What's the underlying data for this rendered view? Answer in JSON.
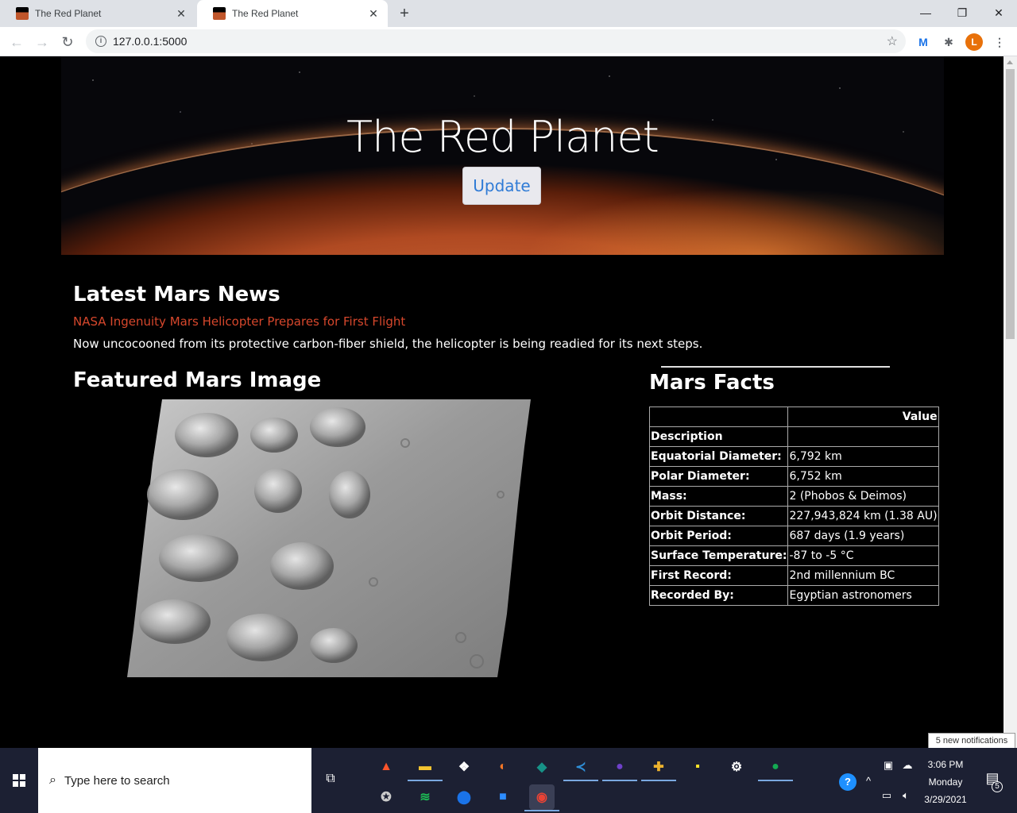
{
  "browser": {
    "tabs": [
      {
        "title": "The Red Planet",
        "active": false
      },
      {
        "title": "The Red Planet",
        "active": true
      }
    ],
    "new_tab_label": "+",
    "url": "127.0.0.1:5000",
    "profile_initial": "L",
    "window_controls": {
      "minimize": "—",
      "restore": "❐",
      "close": "✕"
    }
  },
  "page": {
    "site_title": "The Red Planet",
    "update_button": "Update",
    "news": {
      "heading": "Latest Mars News",
      "title": "NASA Ingenuity Mars Helicopter Prepares for First Flight",
      "teaser": "Now uncocooned from its protective carbon-fiber shield, the helicopter is being readied for its next steps."
    },
    "featured": {
      "heading": "Featured Mars Image"
    },
    "facts": {
      "heading": "Mars Facts",
      "header_row": [
        "",
        "Value"
      ],
      "index_label": "Description",
      "rows": [
        {
          "label": "Equatorial Diameter:",
          "value": "6,792 km"
        },
        {
          "label": "Polar Diameter:",
          "value": "6,752 km"
        },
        {
          "label": "Mass:",
          "value": "2 (Phobos & Deimos)"
        },
        {
          "label": "Orbit Distance:",
          "value": "227,943,824 km (1.38 AU)"
        },
        {
          "label": "Orbit Period:",
          "value": "687 days (1.9 years)"
        },
        {
          "label": "Surface Temperature:",
          "value": "-87 to -5 °C"
        },
        {
          "label": "First Record:",
          "value": "2nd millennium BC"
        },
        {
          "label": "Recorded By:",
          "value": "Egyptian astronomers"
        }
      ]
    }
  },
  "notification_toast": "5 new notifications",
  "taskbar": {
    "search_placeholder": "Type here to search",
    "clock": {
      "time": "3:06 PM",
      "day": "Monday",
      "date": "3/29/2021"
    },
    "notification_count": "5",
    "pinned_icons": [
      {
        "name": "brave-icon",
        "color": "#fb542b"
      },
      {
        "name": "file-explorer-icon",
        "color": "#f4c430"
      },
      {
        "name": "dropbox-icon",
        "color": "#ffffff"
      },
      {
        "name": "jupyter-icon",
        "color": "#f37626"
      },
      {
        "name": "gitkraken-icon",
        "color": "#179287"
      },
      {
        "name": "vscode-icon",
        "color": "#2f8fd8"
      },
      {
        "name": "github-desktop-icon",
        "color": "#6e40c9"
      },
      {
        "name": "slack-icon",
        "color": "#ecb22e"
      },
      {
        "name": "sticky-notes-icon",
        "color": "#ffe629"
      },
      {
        "name": "settings-icon",
        "color": "#ffffff"
      },
      {
        "name": "mongodb-compass-icon",
        "color": "#13aa52"
      },
      {
        "name": "yelp-icon",
        "color": "#cccccc"
      },
      {
        "name": "spotify-icon",
        "color": "#1db954"
      },
      {
        "name": "maps-icon",
        "color": "#1a73e8"
      },
      {
        "name": "zoom-icon",
        "color": "#2d8cff"
      },
      {
        "name": "chrome-icon",
        "color": "#ea4335"
      }
    ]
  }
}
